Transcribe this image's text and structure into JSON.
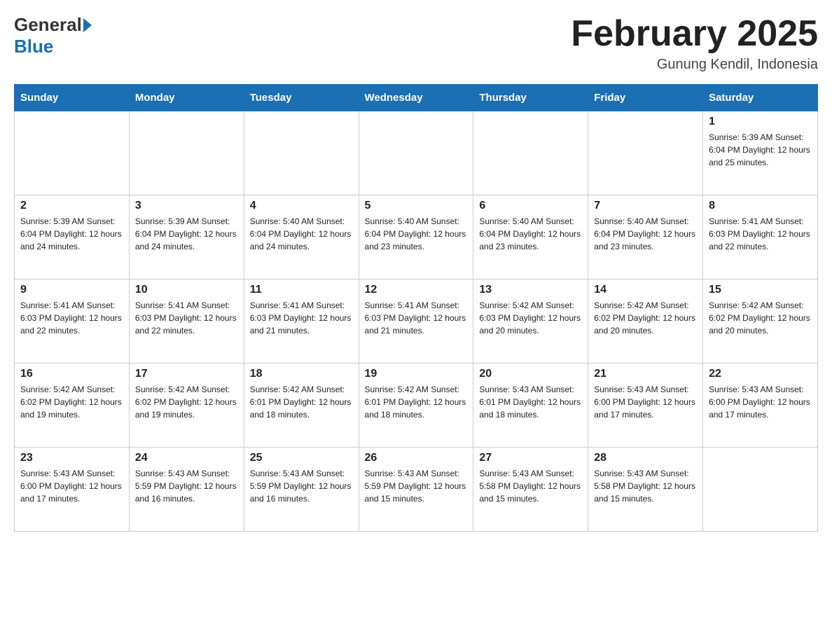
{
  "header": {
    "logo": {
      "general": "General",
      "blue": "Blue"
    },
    "title": "February 2025",
    "location": "Gunung Kendil, Indonesia"
  },
  "weekdays": [
    "Sunday",
    "Monday",
    "Tuesday",
    "Wednesday",
    "Thursday",
    "Friday",
    "Saturday"
  ],
  "weeks": [
    [
      {
        "day": "",
        "info": ""
      },
      {
        "day": "",
        "info": ""
      },
      {
        "day": "",
        "info": ""
      },
      {
        "day": "",
        "info": ""
      },
      {
        "day": "",
        "info": ""
      },
      {
        "day": "",
        "info": ""
      },
      {
        "day": "1",
        "info": "Sunrise: 5:39 AM\nSunset: 6:04 PM\nDaylight: 12 hours\nand 25 minutes."
      }
    ],
    [
      {
        "day": "2",
        "info": "Sunrise: 5:39 AM\nSunset: 6:04 PM\nDaylight: 12 hours\nand 24 minutes."
      },
      {
        "day": "3",
        "info": "Sunrise: 5:39 AM\nSunset: 6:04 PM\nDaylight: 12 hours\nand 24 minutes."
      },
      {
        "day": "4",
        "info": "Sunrise: 5:40 AM\nSunset: 6:04 PM\nDaylight: 12 hours\nand 24 minutes."
      },
      {
        "day": "5",
        "info": "Sunrise: 5:40 AM\nSunset: 6:04 PM\nDaylight: 12 hours\nand 23 minutes."
      },
      {
        "day": "6",
        "info": "Sunrise: 5:40 AM\nSunset: 6:04 PM\nDaylight: 12 hours\nand 23 minutes."
      },
      {
        "day": "7",
        "info": "Sunrise: 5:40 AM\nSunset: 6:04 PM\nDaylight: 12 hours\nand 23 minutes."
      },
      {
        "day": "8",
        "info": "Sunrise: 5:41 AM\nSunset: 6:03 PM\nDaylight: 12 hours\nand 22 minutes."
      }
    ],
    [
      {
        "day": "9",
        "info": "Sunrise: 5:41 AM\nSunset: 6:03 PM\nDaylight: 12 hours\nand 22 minutes."
      },
      {
        "day": "10",
        "info": "Sunrise: 5:41 AM\nSunset: 6:03 PM\nDaylight: 12 hours\nand 22 minutes."
      },
      {
        "day": "11",
        "info": "Sunrise: 5:41 AM\nSunset: 6:03 PM\nDaylight: 12 hours\nand 21 minutes."
      },
      {
        "day": "12",
        "info": "Sunrise: 5:41 AM\nSunset: 6:03 PM\nDaylight: 12 hours\nand 21 minutes."
      },
      {
        "day": "13",
        "info": "Sunrise: 5:42 AM\nSunset: 6:03 PM\nDaylight: 12 hours\nand 20 minutes."
      },
      {
        "day": "14",
        "info": "Sunrise: 5:42 AM\nSunset: 6:02 PM\nDaylight: 12 hours\nand 20 minutes."
      },
      {
        "day": "15",
        "info": "Sunrise: 5:42 AM\nSunset: 6:02 PM\nDaylight: 12 hours\nand 20 minutes."
      }
    ],
    [
      {
        "day": "16",
        "info": "Sunrise: 5:42 AM\nSunset: 6:02 PM\nDaylight: 12 hours\nand 19 minutes."
      },
      {
        "day": "17",
        "info": "Sunrise: 5:42 AM\nSunset: 6:02 PM\nDaylight: 12 hours\nand 19 minutes."
      },
      {
        "day": "18",
        "info": "Sunrise: 5:42 AM\nSunset: 6:01 PM\nDaylight: 12 hours\nand 18 minutes."
      },
      {
        "day": "19",
        "info": "Sunrise: 5:42 AM\nSunset: 6:01 PM\nDaylight: 12 hours\nand 18 minutes."
      },
      {
        "day": "20",
        "info": "Sunrise: 5:43 AM\nSunset: 6:01 PM\nDaylight: 12 hours\nand 18 minutes."
      },
      {
        "day": "21",
        "info": "Sunrise: 5:43 AM\nSunset: 6:00 PM\nDaylight: 12 hours\nand 17 minutes."
      },
      {
        "day": "22",
        "info": "Sunrise: 5:43 AM\nSunset: 6:00 PM\nDaylight: 12 hours\nand 17 minutes."
      }
    ],
    [
      {
        "day": "23",
        "info": "Sunrise: 5:43 AM\nSunset: 6:00 PM\nDaylight: 12 hours\nand 17 minutes."
      },
      {
        "day": "24",
        "info": "Sunrise: 5:43 AM\nSunset: 5:59 PM\nDaylight: 12 hours\nand 16 minutes."
      },
      {
        "day": "25",
        "info": "Sunrise: 5:43 AM\nSunset: 5:59 PM\nDaylight: 12 hours\nand 16 minutes."
      },
      {
        "day": "26",
        "info": "Sunrise: 5:43 AM\nSunset: 5:59 PM\nDaylight: 12 hours\nand 15 minutes."
      },
      {
        "day": "27",
        "info": "Sunrise: 5:43 AM\nSunset: 5:58 PM\nDaylight: 12 hours\nand 15 minutes."
      },
      {
        "day": "28",
        "info": "Sunrise: 5:43 AM\nSunset: 5:58 PM\nDaylight: 12 hours\nand 15 minutes."
      },
      {
        "day": "",
        "info": ""
      }
    ]
  ]
}
